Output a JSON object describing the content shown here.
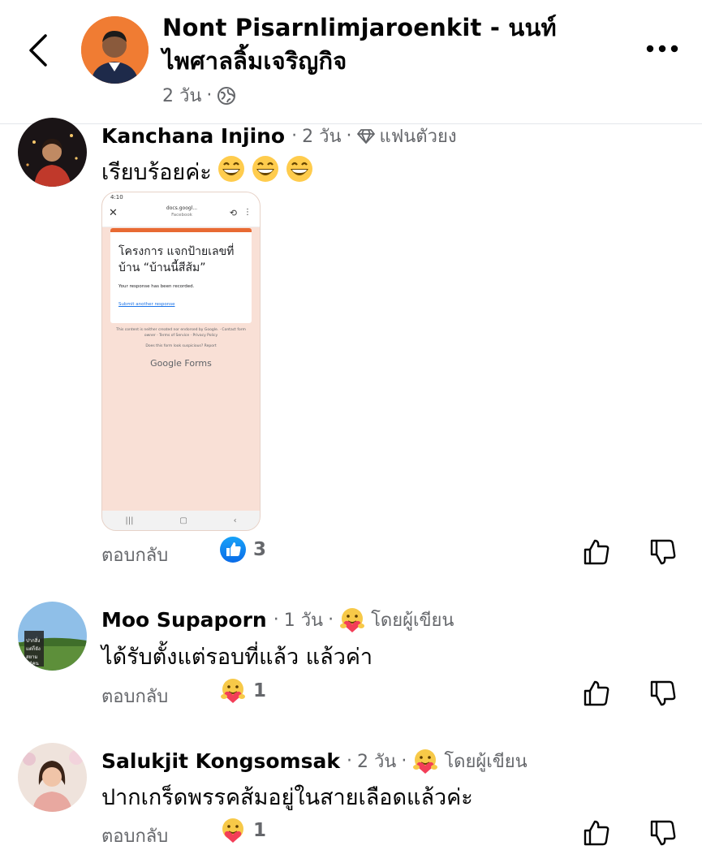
{
  "header": {
    "poster_name": "Nont Pisarnlimjaroenkit - นนท์ ไพศาลลิ้มเจริญกิจ",
    "time": "2 วัน",
    "dot": "·"
  },
  "comments": [
    {
      "name": "Kanchana Injino",
      "time": "2 วัน",
      "dot1": "·",
      "badge": "แฟนตัวยง",
      "text": "เรียบร้อยค่ะ",
      "emoji_count": 3,
      "reply": "ตอบกลับ",
      "reaction_type": "like",
      "reaction_count": "3",
      "attachment": {
        "status": "4:10",
        "url": "docs.googl...",
        "url_sub": "Facebook",
        "form_title": "โครงการ แจกป้ายเลขที่บ้าน “บ้านนี้สีส้ม”",
        "recorded": "Your response has been recorded.",
        "submit_another": "Submit another response",
        "fine_print": "This content is neither created nor endorsed by Google. · Contact form owner · Terms of Service · Privacy Policy",
        "suspicious": "Does this form look suspicious? Report",
        "brand": "Google Forms"
      }
    },
    {
      "name": "Moo Supaporn",
      "time": "1 วัน",
      "dot1": "·",
      "dot2": "·",
      "badge": "โดยผู้เขียน",
      "text": "ได้รับตั้งแต่รอบที่แล้ว แล้วค่า",
      "reply": "ตอบกลับ",
      "reaction_type": "care",
      "reaction_count": "1",
      "avatar_text": "ปากสิ่งแต่ก็ยังสยาม 44 คน"
    },
    {
      "name": "Salukjit Kongsomsak",
      "time": "2 วัน",
      "dot1": "·",
      "dot2": "·",
      "badge": "โดยผู้เขียน",
      "text": "ปากเกร็ดพรรคส้มอยู่ในสายเลือดแล้วค่ะ",
      "reply": "ตอบกลับ",
      "reaction_type": "care",
      "reaction_count": "1"
    }
  ],
  "colors": {
    "text": "#050505",
    "muted": "#65676b",
    "like_blue": "#1877f2",
    "orange": "#f07c33"
  }
}
